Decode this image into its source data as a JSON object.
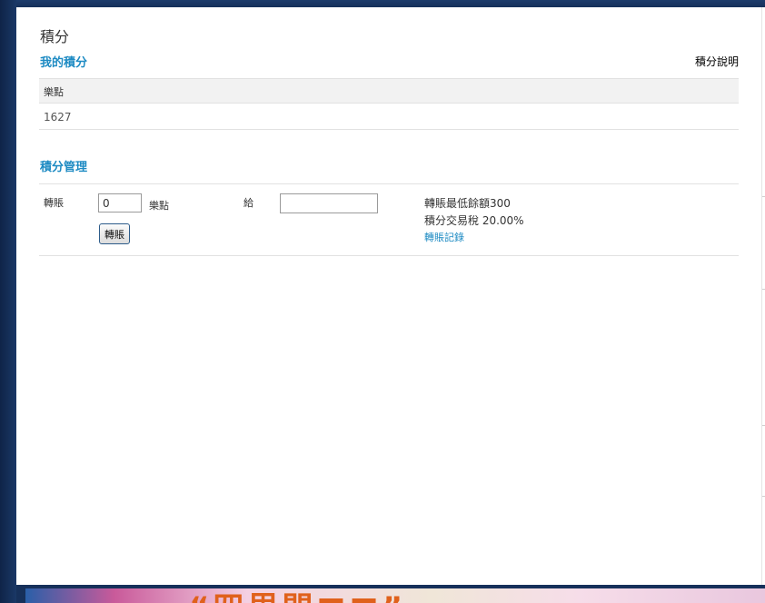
{
  "page_title": "積分",
  "my_points": {
    "section_title": "我的積分",
    "help_link": "積分說明",
    "column_header": "樂點",
    "value": "1627"
  },
  "management": {
    "section_title": "積分管理",
    "transfer_label": "轉賬",
    "amount_value": "0",
    "unit_label": "樂點",
    "to_label": "給",
    "target_value": "",
    "transfer_button": "轉賬",
    "min_balance_text": "轉賬最低餘額300",
    "tax_text": "積分交易稅 20.00%",
    "records_link": "轉賬記錄"
  },
  "banner": {
    "text": "“四里門■■”"
  },
  "colors": {
    "accent": "#1e8bc3",
    "background": "#16305a",
    "panel": "#ffffff"
  }
}
